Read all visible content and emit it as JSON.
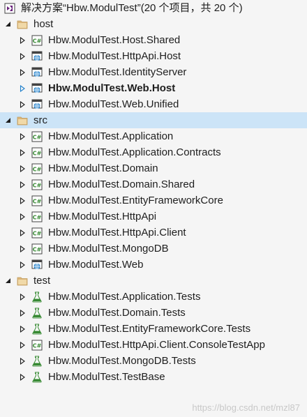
{
  "solution": {
    "label": "解决方案“Hbw.ModulTest”(20 个项目，共 20 个)",
    "icon": "solution-icon"
  },
  "folders": [
    {
      "name": "host",
      "icon": "folder-icon",
      "expanded": true,
      "projects": [
        {
          "name": "Hbw.ModulTest.Host.Shared",
          "icon": "csharp-project-icon"
        },
        {
          "name": "Hbw.ModulTest.HttpApi.Host",
          "icon": "web-project-icon"
        },
        {
          "name": "Hbw.ModulTest.IdentityServer",
          "icon": "web-project-icon"
        },
        {
          "name": "Hbw.ModulTest.Web.Host",
          "icon": "web-project-icon",
          "startup": true
        },
        {
          "name": "Hbw.ModulTest.Web.Unified",
          "icon": "web-project-icon"
        }
      ]
    },
    {
      "name": "src",
      "icon": "folder-icon",
      "expanded": true,
      "selected": true,
      "projects": [
        {
          "name": "Hbw.ModulTest.Application",
          "icon": "csharp-project-icon"
        },
        {
          "name": "Hbw.ModulTest.Application.Contracts",
          "icon": "csharp-project-icon"
        },
        {
          "name": "Hbw.ModulTest.Domain",
          "icon": "csharp-project-icon"
        },
        {
          "name": "Hbw.ModulTest.Domain.Shared",
          "icon": "csharp-project-icon"
        },
        {
          "name": "Hbw.ModulTest.EntityFrameworkCore",
          "icon": "csharp-project-icon"
        },
        {
          "name": "Hbw.ModulTest.HttpApi",
          "icon": "csharp-project-icon"
        },
        {
          "name": "Hbw.ModulTest.HttpApi.Client",
          "icon": "csharp-project-icon"
        },
        {
          "name": "Hbw.ModulTest.MongoDB",
          "icon": "csharp-project-icon"
        },
        {
          "name": "Hbw.ModulTest.Web",
          "icon": "web-project-icon"
        }
      ]
    },
    {
      "name": "test",
      "icon": "folder-icon",
      "expanded": true,
      "projects": [
        {
          "name": "Hbw.ModulTest.Application.Tests",
          "icon": "test-project-icon"
        },
        {
          "name": "Hbw.ModulTest.Domain.Tests",
          "icon": "test-project-icon"
        },
        {
          "name": "Hbw.ModulTest.EntityFrameworkCore.Tests",
          "icon": "test-project-icon"
        },
        {
          "name": "Hbw.ModulTest.HttpApi.Client.ConsoleTestApp",
          "icon": "csharp-project-icon"
        },
        {
          "name": "Hbw.ModulTest.MongoDB.Tests",
          "icon": "test-project-icon"
        },
        {
          "name": "Hbw.ModulTest.TestBase",
          "icon": "test-project-icon"
        }
      ]
    }
  ],
  "watermark": "https://blog.csdn.net/mzl87",
  "colors": {
    "selection": "#cce4f7",
    "csharp_green": "#388a34",
    "web_blue": "#1e7fcb",
    "folder_tan": "#dcb67a",
    "solution_purple": "#68217a"
  }
}
